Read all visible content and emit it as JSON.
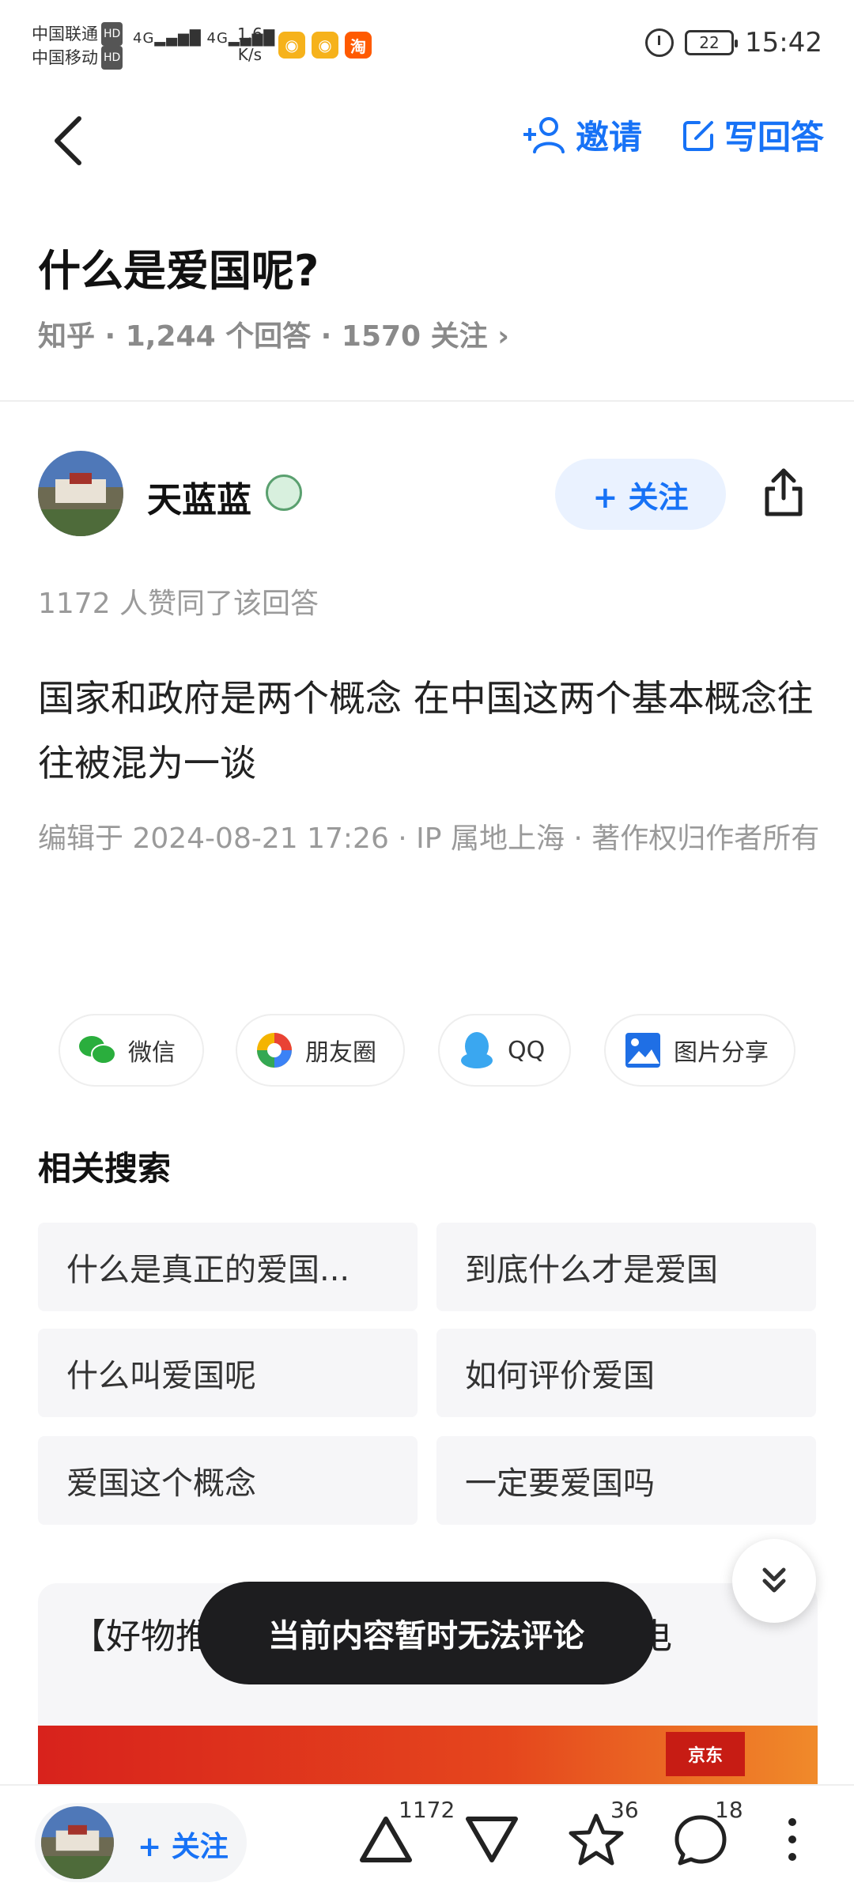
{
  "status_bar": {
    "carrier1": "中国联通",
    "carrier2": "中国移动",
    "hd": "HD",
    "signal": "4G",
    "net_speed_value": "1.6",
    "net_speed_unit": "K/s",
    "taobao_icon_text": "淘",
    "battery": "22",
    "time": "15:42"
  },
  "nav": {
    "invite_label": "邀请",
    "write_answer_label": "写回答"
  },
  "question": {
    "title": "什么是爱国呢?",
    "meta": "知乎 · 1,244 个回答 · 1570 关注 ›"
  },
  "author": {
    "name": "天蓝蓝",
    "follow_label": "+ 关注"
  },
  "answer": {
    "likes_text": "1172 人赞同了该回答",
    "content": "国家和政府是两个概念 在中国这两个基本概念往往被混为一谈",
    "edit_info": "编辑于 2024-08-21 17:26 · IP 属地上海 · 著作权归作者所有"
  },
  "share": {
    "wechat": "微信",
    "moments": "朋友圈",
    "qq": "QQ",
    "image_share": "图片分享"
  },
  "related": {
    "title": "相关搜索",
    "items": [
      "什么是真正的爱国...",
      "到底什么才是爱国",
      "什么叫爱国呢",
      "如何评价爱国",
      "爱国这个概念",
      "一定要爱国吗"
    ]
  },
  "ad": {
    "text": "【好物推荐】... 硬核工艺守护安全用电",
    "brand": "京东"
  },
  "toast": "当前内容暂时无法评论",
  "bottom_bar": {
    "follow_label": "+ 关注",
    "upvote_count": "1172",
    "favorite_count": "36",
    "comment_count": "18"
  },
  "colors": {
    "accent": "#1772f6",
    "toast_bg": "#1d1d1f"
  }
}
